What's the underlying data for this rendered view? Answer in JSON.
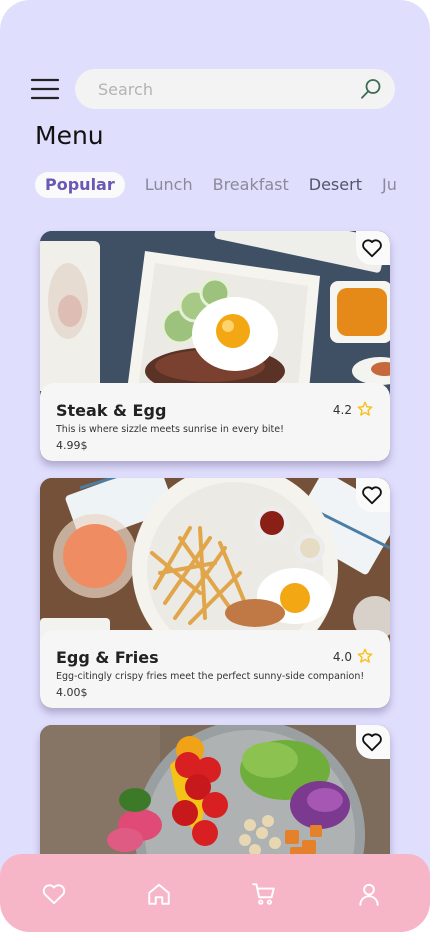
{
  "header": {
    "menu_icon": "hamburger-icon",
    "search": {
      "placeholder": "Search",
      "icon": "search-icon"
    },
    "title": "Menu"
  },
  "tabs": [
    {
      "label": "Popular",
      "active": true
    },
    {
      "label": "Lunch",
      "active": false
    },
    {
      "label": "Breakfast",
      "active": false
    },
    {
      "label": "Desert",
      "active": false
    },
    {
      "label": "Ju",
      "active": false
    }
  ],
  "items": [
    {
      "name": "Steak & Egg",
      "description": "This is where sizzle meets sunrise in every bite!",
      "price": "4.99$",
      "rating": "4.2"
    },
    {
      "name": "Egg & Fries",
      "description": "Egg-citingly crispy fries meet the perfect sunny-side companion!",
      "price": "4.00$",
      "rating": "4.0"
    },
    {
      "name": "",
      "description": "",
      "price": "",
      "rating": ""
    }
  ],
  "bottom_nav": [
    {
      "icon": "heart-icon"
    },
    {
      "icon": "home-icon"
    },
    {
      "icon": "cart-icon"
    },
    {
      "icon": "profile-icon"
    }
  ],
  "colors": {
    "background": "#e0defd",
    "accent": "#6a58b5",
    "bottom_nav": "#f7b6c7",
    "star": "#f6c21c"
  }
}
